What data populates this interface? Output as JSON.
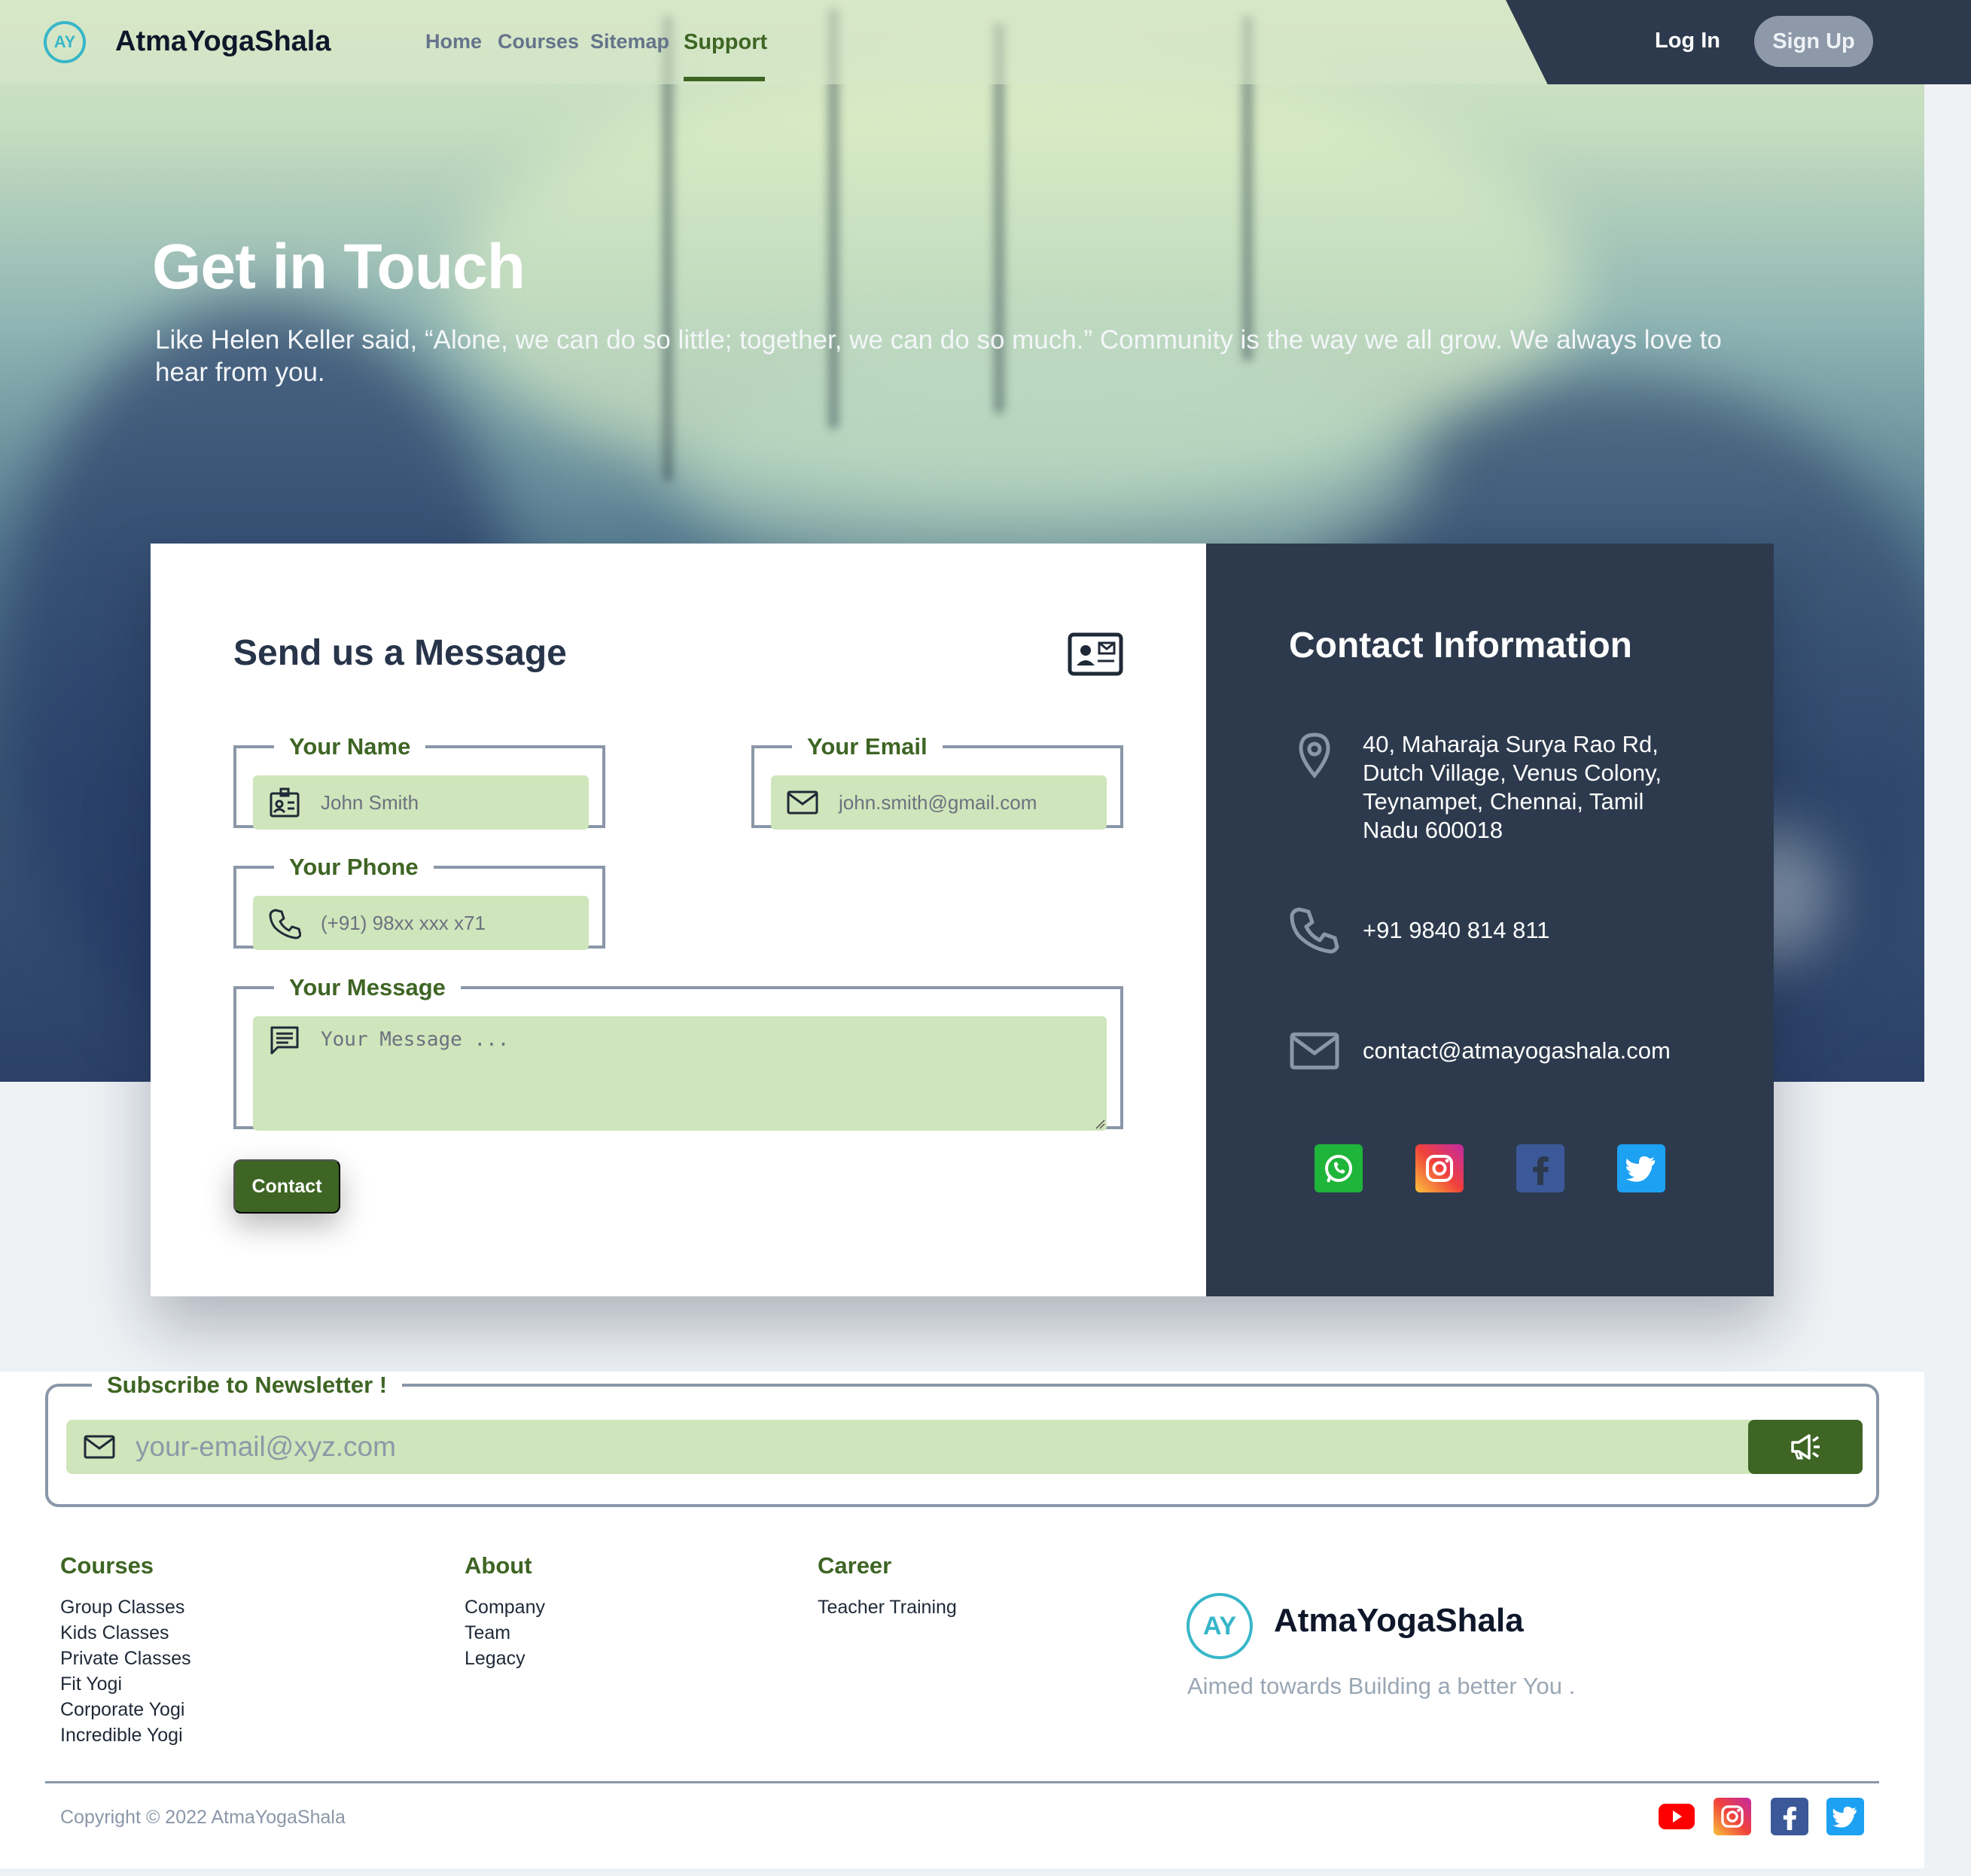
{
  "nav": {
    "logo_text": "AY",
    "brand": "AtmaYogaShala",
    "links": [
      "Home",
      "Courses",
      "Sitemap",
      "Support"
    ],
    "active": "Support",
    "login": "Log In",
    "signup": "Sign Up"
  },
  "hero": {
    "title": "Get in Touch",
    "subtitle": "Like Helen Keller said, “Alone, we can do so little; together, we can do so much.” Community is the way we all grow. We always love to hear from you."
  },
  "form": {
    "title": "Send us a Message",
    "name_label": "Your Name",
    "name_placeholder": "John Smith",
    "email_label": "Your Email",
    "email_placeholder": "john.smith@gmail.com",
    "phone_label": "Your Phone",
    "phone_placeholder": "(+91) 98xx xxx x71",
    "message_label": "Your Message",
    "message_placeholder": "Your Message ...",
    "submit": "Contact"
  },
  "contact_info": {
    "title": "Contact Information",
    "address": "40, Maharaja Surya Rao Rd, Dutch Village, Venus Colony, Teynampet, Chennai, Tamil Nadu 600018",
    "phone": "+91 9840 814 811",
    "email": "contact@atmayogashala.com",
    "socials": [
      "whatsapp-icon",
      "instagram-icon",
      "facebook-icon",
      "twitter-icon"
    ]
  },
  "newsletter": {
    "label": "Subscribe to Newsletter !",
    "placeholder": "your-email@xyz.com"
  },
  "footer": {
    "courses": {
      "heading": "Courses",
      "items": [
        "Group Classes",
        "Kids Classes",
        "Private Classes",
        "Fit Yogi",
        "Corporate Yogi",
        "Incredible Yogi"
      ]
    },
    "about": {
      "heading": "About",
      "items": [
        "Company",
        "Team",
        "Legacy"
      ]
    },
    "career": {
      "heading": "Career",
      "items": [
        "Teacher Training"
      ]
    },
    "logo_text": "AY",
    "brand": "AtmaYogaShala",
    "tagline": "Aimed towards Building a better You .",
    "copyright": "Copyright © 2022 AtmaYogaShala",
    "socials": [
      "youtube-icon",
      "instagram-icon",
      "facebook-icon",
      "twitter-icon"
    ]
  },
  "colors": {
    "accent_green": "#3e6524",
    "input_fill": "#cfe5bb",
    "dark_panel": "#2d3a4d",
    "logo_teal": "#38b6c9"
  }
}
